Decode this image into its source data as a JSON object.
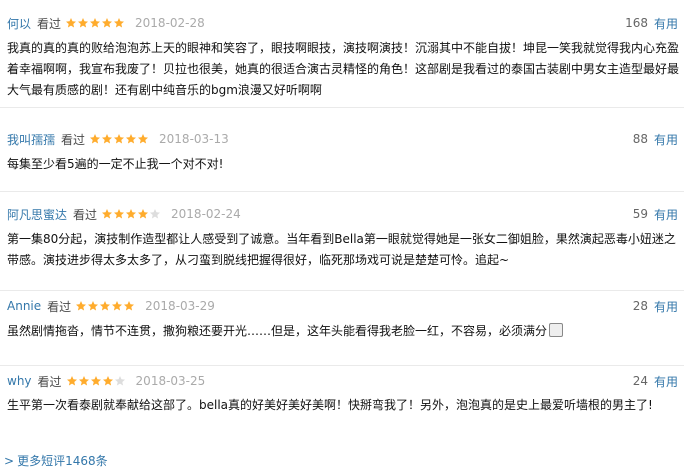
{
  "reviews": [
    {
      "author": "何以",
      "status": "看过",
      "stars": 5,
      "date": "2018-02-28",
      "votes": "168",
      "vote_label": "有用",
      "text": "我真的真的真的败给泡泡苏上天的眼神和笑容了，眼技啊眼技，演技啊演技！沉溺其中不能自拔！坤昆一笑我就觉得我内心充盈着幸福啊啊，我宣布我废了！贝拉也很美，她真的很适合演古灵精怪的角色！这部剧是我看过的泰国古装剧中男女主造型最好最大气最有质感的剧！还有剧中纯音乐的bgm浪漫又好听啊啊"
    },
    {
      "author": "我叫孺孺",
      "status": "看过",
      "stars": 5,
      "date": "2018-03-13",
      "votes": "88",
      "vote_label": "有用",
      "text": "每集至少看5遍的一定不止我一个对不对!"
    },
    {
      "author": "阿凡思蜜达",
      "status": "看过",
      "stars": 4,
      "date": "2018-02-24",
      "votes": "59",
      "vote_label": "有用",
      "text": "第一集80分起，演技制作造型都让人感受到了诚意。当年看到Bella第一眼就觉得她是一张女二御姐脸，果然演起恶毒小妞迷之带感。演技进步得太多太多了，从刁蛮到脱线把握得很好，临死那场戏可说是楚楚可怜。追起~"
    },
    {
      "author": "Annie",
      "status": "看过",
      "stars": 5,
      "date": "2018-03-29",
      "votes": "28",
      "vote_label": "有用",
      "text": "虽然剧情拖沓，情节不连贯，撒狗粮还要开光……但是，这年头能看得我老脸一红，不容易，必须满分"
    },
    {
      "author": "why",
      "status": "看过",
      "stars": 4,
      "date": "2018-03-25",
      "votes": "24",
      "vote_label": "有用",
      "text": "生平第一次看泰剧就奉献给这部了。bella真的好美好美好美啊！快掰弯我了！另外，泡泡真的是史上最爱听墙根的男主了!"
    }
  ],
  "more_link": "更多短评1468条",
  "colors": {
    "link": "#3377aa",
    "star": "#ffac2d",
    "star_empty": "#dddddd"
  }
}
